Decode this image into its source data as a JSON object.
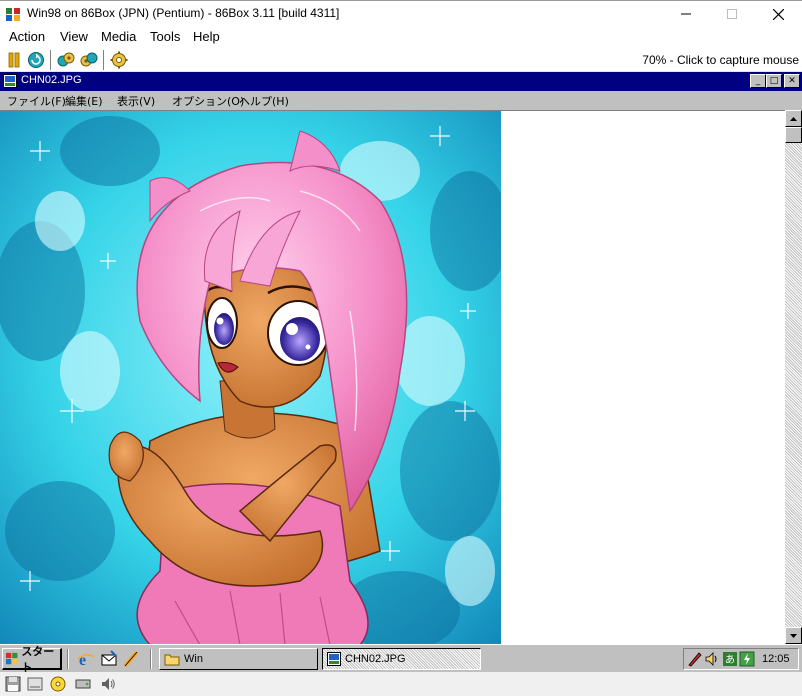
{
  "host": {
    "title": "Win98 on 86Box (JPN) (Pentium) - 86Box 3.11 [build 4311]",
    "menu": [
      "Action",
      "View",
      "Media",
      "Tools",
      "Help"
    ],
    "toolbar_icons": [
      "pause-icon",
      "reset-icon",
      "ctrl-alt-del-icon",
      "ctrl-alt-esc-icon",
      "settings-icon"
    ],
    "capture_status": "70% - Click to capture mouse"
  },
  "viewer": {
    "title": "CHN02.JPG",
    "menu": [
      "ファイル(F)",
      "編集(E)",
      "表示(V)",
      "オプション(O)",
      "ヘルプ(H)"
    ],
    "caption_buttons": {
      "minimize": "_",
      "maximize": "□",
      "close": "✕"
    }
  },
  "taskbar": {
    "start_label": "スタート",
    "tasks": [
      {
        "label": "Win",
        "icon": "folder-icon",
        "active": false
      },
      {
        "label": "CHN02.JPG",
        "icon": "image-viewer-icon",
        "active": true
      }
    ],
    "clock": "12:05"
  },
  "colors": {
    "win98_titlebar": "#000080",
    "win98_face": "#c0c0c0",
    "hair_pink": "#f58fc9",
    "skin": "#d9843f",
    "background_cyan": "#35d3e8"
  }
}
